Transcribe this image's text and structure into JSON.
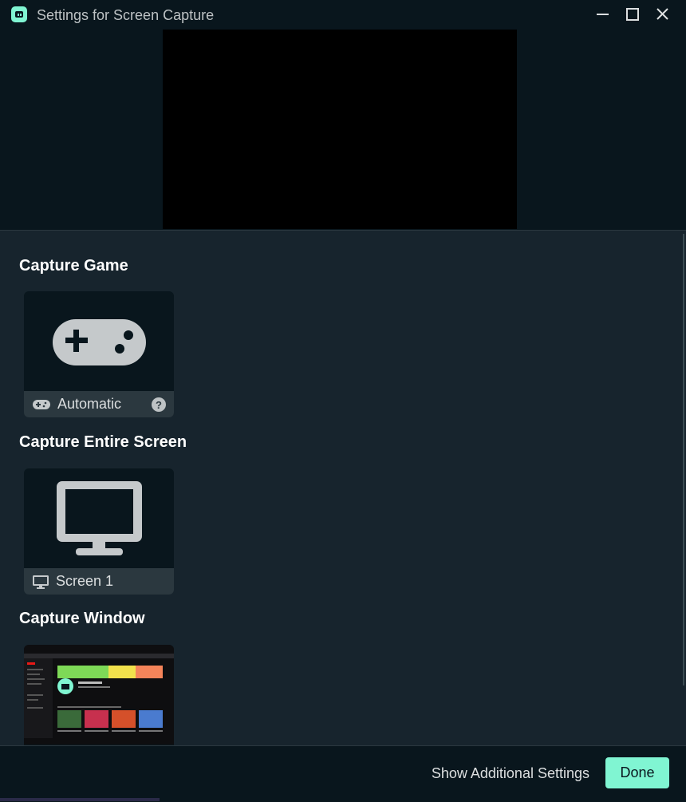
{
  "window": {
    "title": "Settings for Screen Capture",
    "controls": [
      "minimize-icon",
      "maximize-icon",
      "close-icon"
    ]
  },
  "sections": {
    "game": {
      "title": "Capture Game",
      "card": {
        "label": "Automatic",
        "help": "?",
        "icon": "gamepad-icon"
      }
    },
    "screen": {
      "title": "Capture Entire Screen",
      "card": {
        "label": "Screen 1",
        "icon": "monitor-icon"
      }
    },
    "window": {
      "title": "Capture Window",
      "card": {
        "icon": "window-thumbnail"
      }
    }
  },
  "footer": {
    "show_additional": "Show Additional Settings",
    "done": "Done"
  },
  "colors": {
    "accent": "#80f5d2",
    "background": "#17242d",
    "panel": "#09161d",
    "card_footer": "#2b383f"
  }
}
